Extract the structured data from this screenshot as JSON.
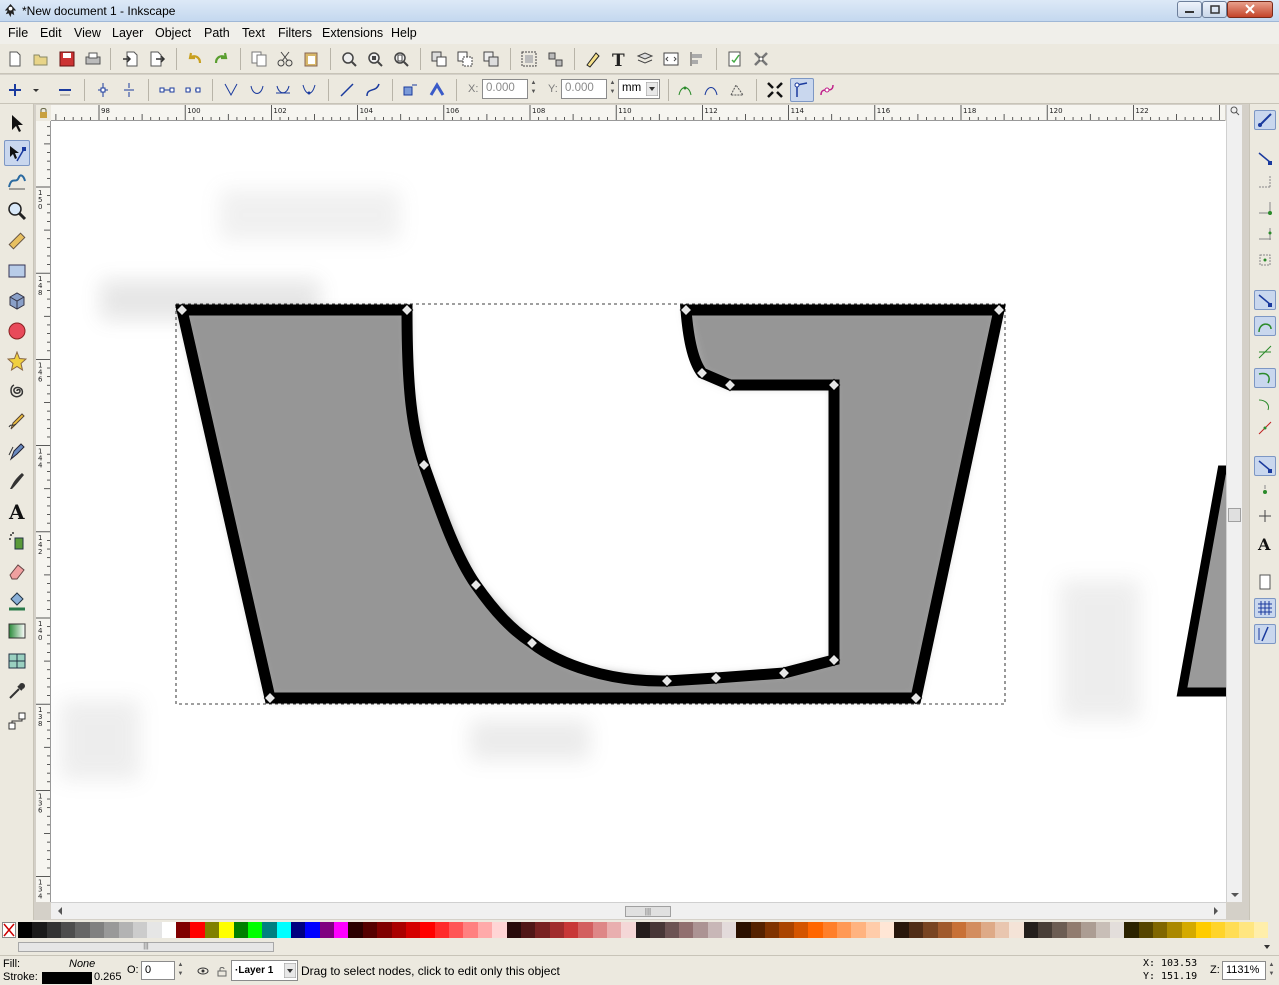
{
  "window": {
    "title": "*New document 1 - Inkscape"
  },
  "menubar": {
    "items": [
      "File",
      "Edit",
      "View",
      "Layer",
      "Object",
      "Path",
      "Text",
      "Filters",
      "Extensions",
      "Help"
    ]
  },
  "controls": {
    "x_label": "X:",
    "x_value": "0.000",
    "y_label": "Y:",
    "y_value": "0.000",
    "unit": "mm"
  },
  "rulers": {
    "horizontal_ticks": [
      "98",
      "100",
      "102",
      "104",
      "106",
      "108",
      "110",
      "112",
      "114",
      "116",
      "118",
      "120",
      "122"
    ],
    "vertical_ticks": [
      "150",
      "148",
      "146",
      "144",
      "142",
      "140",
      "138",
      "136",
      "134"
    ]
  },
  "tools": [
    {
      "name": "selector-tool-icon",
      "active": false
    },
    {
      "name": "node-tool-icon",
      "active": true
    },
    {
      "name": "tweak-tool-icon",
      "active": false
    },
    {
      "name": "zoom-tool-icon",
      "active": false
    },
    {
      "name": "measure-tool-icon",
      "active": false
    },
    {
      "name": "rectangle-tool-icon",
      "active": false
    },
    {
      "name": "3d-box-tool-icon",
      "active": false
    },
    {
      "name": "ellipse-tool-icon",
      "active": false
    },
    {
      "name": "star-tool-icon",
      "active": false
    },
    {
      "name": "spiral-tool-icon",
      "active": false
    },
    {
      "name": "pencil-tool-icon",
      "active": false
    },
    {
      "name": "pen-tool-icon",
      "active": false
    },
    {
      "name": "calligraphy-tool-icon",
      "active": false
    },
    {
      "name": "text-tool-icon",
      "active": false
    },
    {
      "name": "spray-tool-icon",
      "active": false
    },
    {
      "name": "eraser-tool-icon",
      "active": false
    },
    {
      "name": "paint-bucket-tool-icon",
      "active": false
    },
    {
      "name": "gradient-tool-icon",
      "active": false
    },
    {
      "name": "mesh-tool-icon",
      "active": false
    },
    {
      "name": "dropper-tool-icon",
      "active": false
    },
    {
      "name": "connector-tool-icon",
      "active": false
    }
  ],
  "palette": {
    "colors": [
      "#000000",
      "#1a1a1a",
      "#333333",
      "#4d4d4d",
      "#666666",
      "#808080",
      "#999999",
      "#b3b3b3",
      "#cccccc",
      "#e6e6e6",
      "#ffffff",
      "#800000",
      "#ff0000",
      "#808000",
      "#ffff00",
      "#008000",
      "#00ff00",
      "#008080",
      "#00ffff",
      "#000080",
      "#0000ff",
      "#800080",
      "#ff00ff",
      "#2b0000",
      "#550000",
      "#800000",
      "#aa0000",
      "#d40000",
      "#ff0000",
      "#ff2a2a",
      "#ff5555",
      "#ff8080",
      "#ffaaaa",
      "#ffd5d5",
      "#280b0b",
      "#501616",
      "#782121",
      "#a02c2c",
      "#c83737",
      "#d35f5f",
      "#de8787",
      "#e9afaf",
      "#f4d7d7",
      "#241c1c",
      "#483737",
      "#6c5353",
      "#916f6f",
      "#ac9393",
      "#c8b7b7",
      "#e3dbdb",
      "#2b1100",
      "#552200",
      "#803300",
      "#aa4400",
      "#d45500",
      "#ff6600",
      "#ff7f2a",
      "#ff9955",
      "#ffb380",
      "#ffccaa",
      "#ffe6d5",
      "#28170b",
      "#502d16",
      "#784421",
      "#a05a2c",
      "#c87137",
      "#d38d5f",
      "#deaa87",
      "#e9c6af",
      "#f4e3d7",
      "#241f1c",
      "#483e37",
      "#6c5d53",
      "#917c6f",
      "#ac9d93",
      "#c8beb7",
      "#e3dedb",
      "#2b2200",
      "#554400",
      "#806600",
      "#aa8800",
      "#d4aa00",
      "#ffcc00",
      "#ffd42a",
      "#ffdd55",
      "#ffe680",
      "#ffeeaa"
    ]
  },
  "status": {
    "fill_label": "Fill:",
    "fill_value": "None",
    "stroke_label": "Stroke:",
    "stroke_width": "0.265",
    "opacity_label": "O:",
    "opacity_value": "0",
    "layer": "·Layer 1",
    "message": "Drag to select nodes, click to edit only this object",
    "x_label": "X:",
    "x_value": "103.53",
    "y_label": "Y:",
    "y_value": "151.19",
    "zoom_label": "Z:",
    "zoom_value": "1131%"
  }
}
